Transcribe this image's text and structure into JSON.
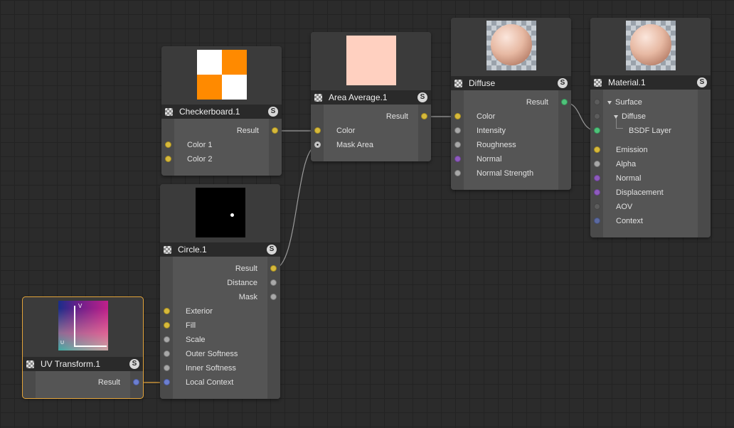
{
  "colors": {
    "canvas_bg": "#2b2b2b",
    "selection": "#e3a43a",
    "wire": "#9a9a9a",
    "port_yellow": "#d6b93c",
    "port_green": "#4fc27a",
    "port_purple": "#8e5bbd",
    "port_blue": "#6c7fd0"
  },
  "badge": "S",
  "nodes": {
    "checkerboard": {
      "title": "Checkerboard.1",
      "output": "Result",
      "inputs": [
        "Color 1",
        "Color 2"
      ],
      "preview": "orange-white-checker"
    },
    "circle": {
      "title": "Circle.1",
      "outputs": [
        "Result",
        "Distance",
        "Mask"
      ],
      "inputs": [
        "Exterior",
        "Fill",
        "Scale",
        "Outer Softness",
        "Inner Softness",
        "Local Context"
      ],
      "preview": "black-with-white-dot"
    },
    "uv_transform": {
      "title": "UV Transform.1",
      "output": "Result",
      "selected": true,
      "axis_v": "V",
      "axis_u": "U",
      "preview": "uv-gradient"
    },
    "area_average": {
      "title": "Area Average.1",
      "output": "Result",
      "inputs": [
        "Color",
        "Mask Area"
      ],
      "preview_color": "#ffd0c0"
    },
    "diffuse": {
      "title": "Diffuse",
      "output": "Result",
      "inputs": [
        "Color",
        "Intensity",
        "Roughness",
        "Normal",
        "Normal Strength"
      ],
      "preview": "sphere"
    },
    "material": {
      "title": "Material.1",
      "tree": [
        "Surface",
        "Diffuse",
        "BSDF Layer"
      ],
      "inputs": [
        "Emission",
        "Alpha",
        "Normal",
        "Displacement",
        "AOV",
        "Context"
      ],
      "preview": "sphere"
    }
  }
}
